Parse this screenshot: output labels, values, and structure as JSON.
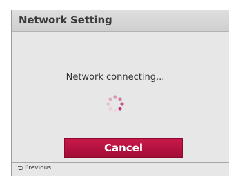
{
  "dialog": {
    "title": "Network Setting",
    "message": "Network connecting...",
    "cancel_label": "Cancel",
    "previous_label": "Previous"
  },
  "icons": {
    "spinner": "loading-spinner-icon",
    "previous": "return-arrow-icon"
  },
  "colors": {
    "cancel_button": "#b01240",
    "spinner_dots": "#c45a8a",
    "dialog_background": "#e7e7e7",
    "title_background": "#d6d6d6"
  }
}
